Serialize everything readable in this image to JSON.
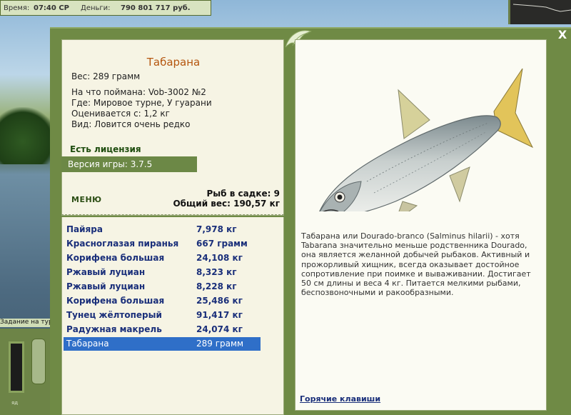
{
  "top_bar": {
    "time_label": "Время:",
    "time_value": "07:40 СР",
    "money_label": "Деньги:",
    "money_value": "790 801 717 руб."
  },
  "side": {
    "task_label": "Задание на тур",
    "gauge_label": "яд"
  },
  "window": {
    "close_label": "X"
  },
  "fish": {
    "name": "Табарана",
    "weight_line": "Вес: 289 грамм",
    "caught_with": "На что поймана: Vob-3002 №2",
    "where": "Где: Мировое турне, У гуарани",
    "valued_from": "Оценивается с: 1,2 кг",
    "rarity": "Вид: Ловится очень редко",
    "description": "Табарана или Dourado-branco (Salminus hilarii) - хотя Tabarana значительно меньше родственника Dourado, она является желанной добычей рыбаков. Активный и прожорливый хищник, всегда оказывает достойное сопротивление при поимке и вываживании. Достигает 50 см длины и веса 4 кг. Питается мелкими рыбами, беспозвоночными и ракообразными."
  },
  "license": "Есть лицензия",
  "version": "Версия игры: 3.7.5",
  "menu_label": "МЕНЮ",
  "keep": {
    "count": "Рыб в садке: 9",
    "total": "Общий вес: 190,57 кг"
  },
  "catch_list": [
    {
      "name": "Пайяра",
      "weight": "7,978 кг"
    },
    {
      "name": "Красноглазая пиранья",
      "weight": "667 грамм"
    },
    {
      "name": "Корифена большая",
      "weight": "24,108 кг"
    },
    {
      "name": "Ржавый луциан",
      "weight": "8,323 кг"
    },
    {
      "name": "Ржавый луциан",
      "weight": "8,228 кг"
    },
    {
      "name": "Корифена большая",
      "weight": "25,486 кг"
    },
    {
      "name": "Тунец жёлтоперый",
      "weight": "91,417 кг"
    },
    {
      "name": "Радужная макрель",
      "weight": "24,074 кг"
    },
    {
      "name": "Табарана",
      "weight": "289 грамм"
    }
  ],
  "selected_index": 8,
  "hotkeys_label": "Горячие клавиши",
  "colors": {
    "frame_green": "#6f8a45",
    "title_orange": "#b5560f",
    "list_blue": "#1a2f7a",
    "selection": "#2f6fc8"
  },
  "icons": {
    "close": "close-icon",
    "leaf": "leaf-ornament-icon",
    "fish": "fish-image"
  }
}
